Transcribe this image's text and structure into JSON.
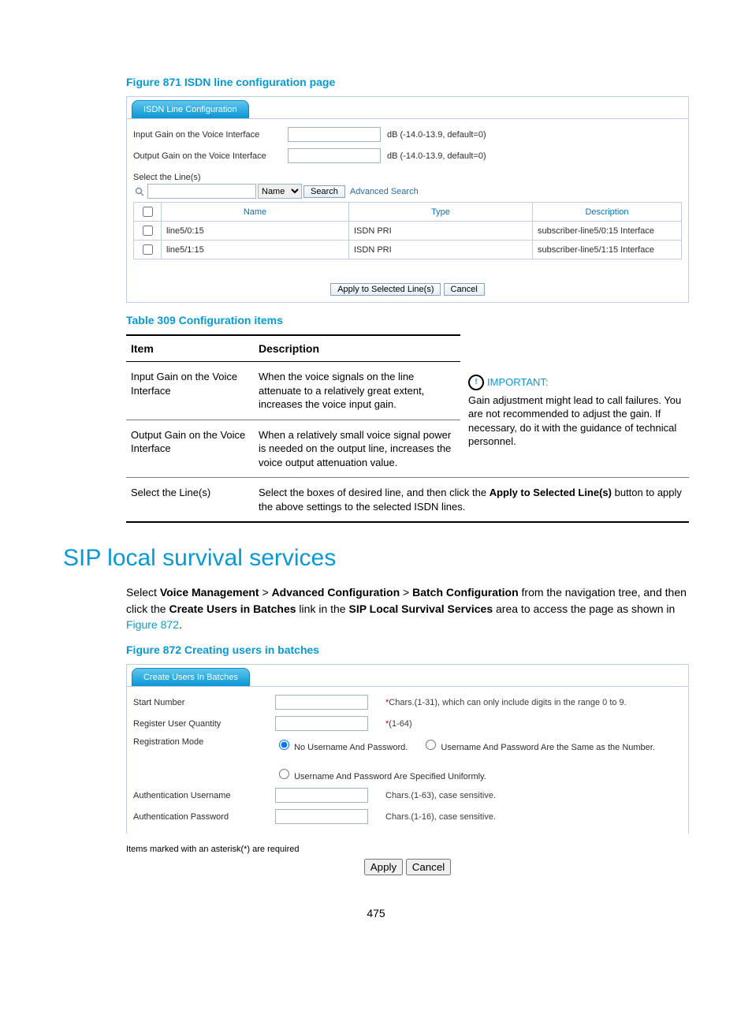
{
  "figure871": {
    "caption": "Figure 871 ISDN line configuration page",
    "tab": "ISDN Line Configuration",
    "inputGainLabel": "Input Gain on the Voice Interface",
    "outputGainLabel": "Output Gain on the Voice Interface",
    "gainRange": "dB (-14.0-13.9, default=0)",
    "selectLabel": "Select the Line(s)",
    "searchFieldOption": "Name",
    "searchBtn": "Search",
    "advanced": "Advanced Search",
    "columns": {
      "name": "Name",
      "type": "Type",
      "desc": "Description"
    },
    "rows": [
      {
        "name": "line5/0:15",
        "type": "ISDN PRI",
        "desc": "subscriber-line5/0:15 Interface"
      },
      {
        "name": "line5/1:15",
        "type": "ISDN PRI",
        "desc": "subscriber-line5/1:15 Interface"
      }
    ],
    "applyBtn": "Apply to Selected Line(s)",
    "cancelBtn": "Cancel"
  },
  "table309": {
    "caption": "Table 309 Configuration items",
    "head": {
      "item": "Item",
      "desc": "Description"
    },
    "row1": {
      "item": "Input Gain on the Voice Interface",
      "desc": "When the voice signals on the line attenuate to a relatively great extent, increases the voice input gain."
    },
    "row2": {
      "item": "Output Gain on the Voice Interface",
      "desc": "When a relatively small voice signal power is needed on the output line, increases the voice output attenuation value."
    },
    "important": {
      "label": "IMPORTANT:",
      "text": "Gain adjustment might lead to call failures. You are not recommended to adjust the gain. If necessary, do it with the guidance of technical personnel."
    },
    "row3": {
      "item": "Select the Line(s)",
      "desc_pre": "Select the boxes of desired line, and then click the ",
      "desc_bold": "Apply to Selected Line(s)",
      "desc_post": " button to apply the above settings to the selected ISDN lines."
    }
  },
  "section": {
    "heading": "SIP local survival services",
    "para_pre": "Select ",
    "b1": "Voice Management",
    "sep": " > ",
    "b2": "Advanced Configuration",
    "b3": "Batch Configuration",
    "mid": " from the navigation tree, and then click the ",
    "b4": "Create Users in Batches",
    "mid2": " link in the ",
    "b5": "SIP Local Survival Services",
    "mid3": " area to access the page as shown in ",
    "link": "Figure 872",
    "end": "."
  },
  "figure872": {
    "caption": "Figure 872 Creating users in batches",
    "tab": "Create Users In Batches",
    "startNum": "Start Number",
    "startHelp": "*Chars.(1-31), which can only include digits in the range 0 to 9.",
    "regQty": "Register User Quantity",
    "regHelp": "*(1-64)",
    "regMode": "Registration Mode",
    "radio": {
      "a": "No Username And Password.",
      "b": "Username And Password Are the Same as the Number.",
      "c": "Username And Password Are Specified Uniformly."
    },
    "authUser": "Authentication Username",
    "authUserHelp": "Chars.(1-63), case sensitive.",
    "authPwd": "Authentication Password",
    "authPwdHelp": "Chars.(1-16), case sensitive.",
    "footnote": "Items marked with an asterisk(*) are required",
    "applyBtn": "Apply",
    "cancelBtn": "Cancel"
  },
  "pageNumber": "475"
}
